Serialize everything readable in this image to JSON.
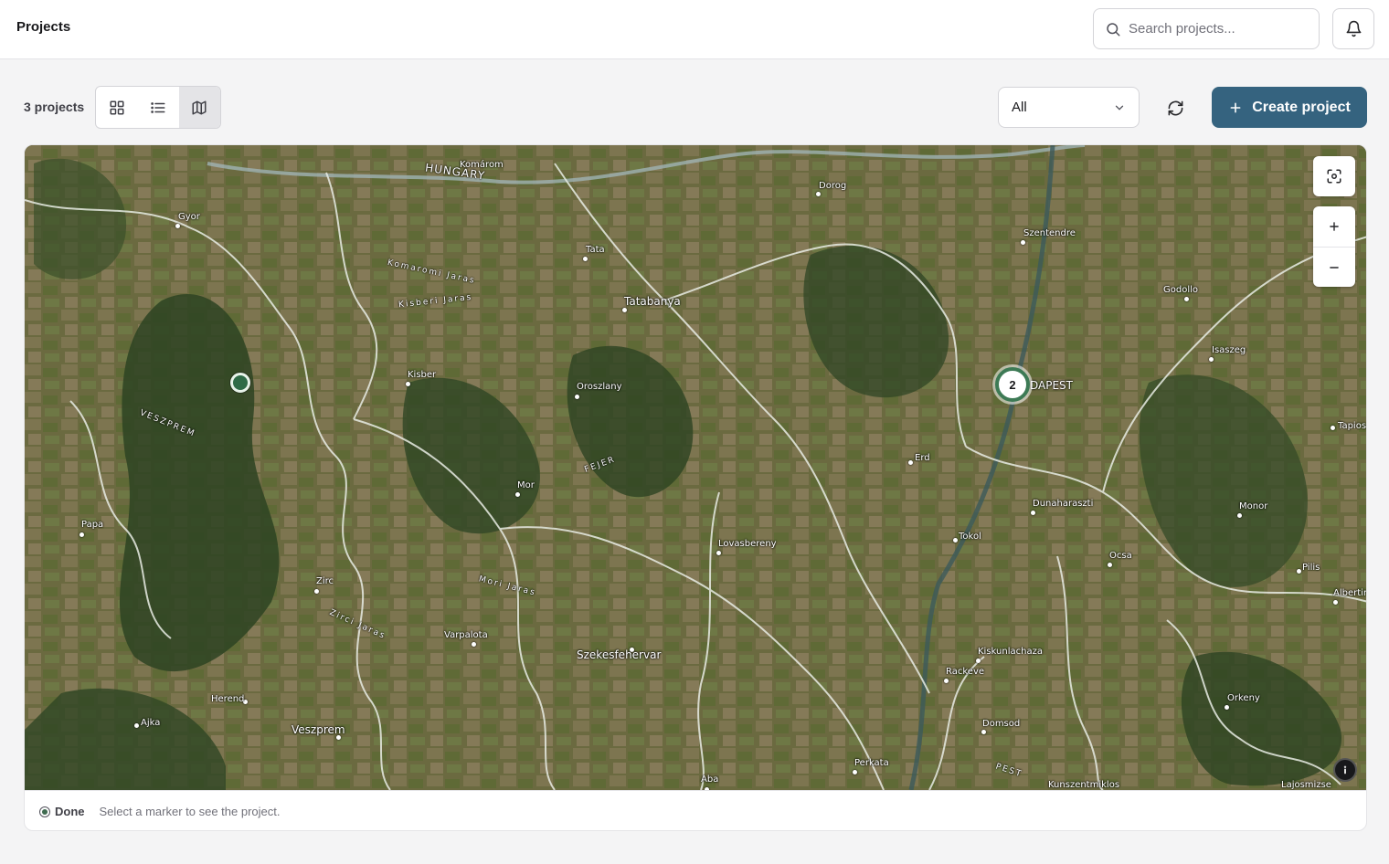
{
  "header": {
    "title": "Projects",
    "search_placeholder": "Search projects...",
    "search_value": ""
  },
  "toolbar": {
    "count_label": "3 projects",
    "views": [
      {
        "name": "grid-view",
        "icon": "grid-icon",
        "active": false
      },
      {
        "name": "list-view",
        "icon": "list-icon",
        "active": false
      },
      {
        "name": "map-view",
        "icon": "map-icon",
        "active": true
      }
    ],
    "filter_value": "All",
    "create_label": "Create project",
    "accent_color": "#35637f"
  },
  "map": {
    "cluster_count": "2",
    "labels": {
      "komarom": "Komárom",
      "hungary": "HUNGARY",
      "dorog": "Dorog",
      "gyor": "Gyor",
      "tata": "Tata",
      "szentendre": "Szentendre",
      "komaromi_jaras": "Komaromi Jaras",
      "kisberi_jaras": "Kisberi Jaras",
      "tatabanya": "Tatabanya",
      "godollo": "Godollo",
      "isaszeg": "Isaszeg",
      "kisber": "Kisber",
      "oroszlany": "Oroszlany",
      "budapest": "DAPEST",
      "veszprem_region": "VESZPREM",
      "tapiosz": "Tapiosz",
      "erd": "Erd",
      "fejer": "FEJER",
      "mor": "Mor",
      "dunaharaszti": "Dunaharaszti",
      "monor": "Monor",
      "papa": "Papa",
      "tokol": "Tokol",
      "lovasbereny": "Lovasbereny",
      "ocsa": "Ocsa",
      "pilis": "Pilis",
      "zirc": "Zirc",
      "mori_jaras": "Mori Jaras",
      "albertir": "Albertir",
      "zirci_jaras": "Zirci Jaras",
      "varpalota": "Varpalota",
      "szekesfehervar": "Szekesfehervar",
      "kiskunlachaza": "Kiskunlachaza",
      "rackeve": "Rackeve",
      "herend": "Herend",
      "orkeny": "Orkeny",
      "ajka": "Ajka",
      "veszprem": "Veszprem",
      "domsod": "Domsod",
      "perkata": "Perkata",
      "aba": "Aba",
      "pest": "PEST",
      "kunszentmiklos": "Kunszentmiklos",
      "lajosmizse": "Lajosmizse"
    }
  },
  "legend": {
    "status_label": "Done",
    "hint": "Select a marker to see the project."
  }
}
